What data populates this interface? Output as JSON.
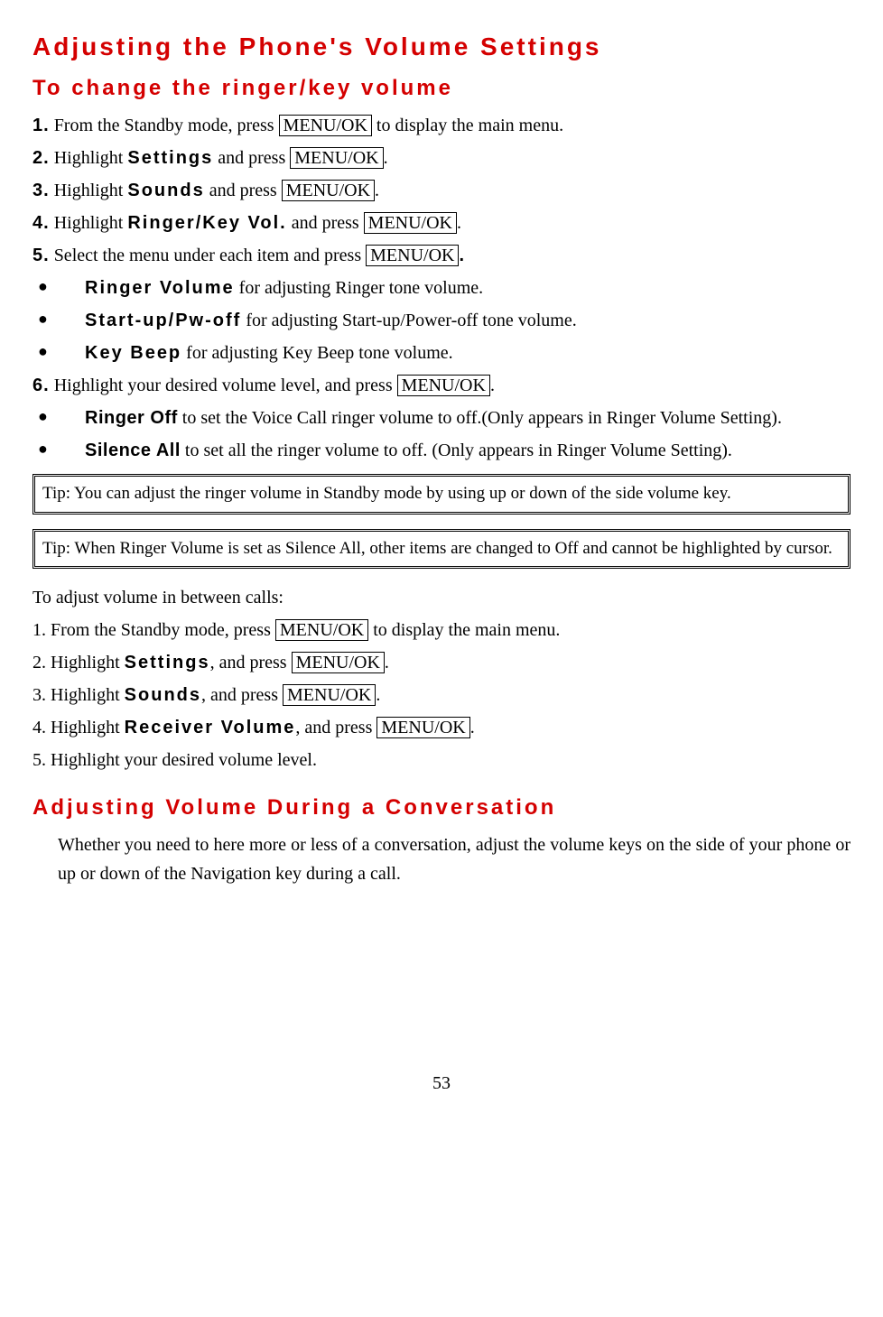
{
  "h1": "Adjusting the Phone's Volume Settings",
  "h2": "To change the ringer/key volume",
  "menuok": "MENU/OK",
  "s1": {
    "n1": "1.",
    "t1a": " From the Standby mode, press ",
    "t1b": " to display the main menu.",
    "n2": "2.",
    "t2a": " Highlight ",
    "t2h": "Settings",
    "t2b": " and press ",
    "t2c": ".",
    "n3": "3.",
    "t3a": " Highlight ",
    "t3h": "Sounds",
    "t3b": " and press ",
    "t3c": ".",
    "n4": "4.",
    "t4a": " Highlight ",
    "t4h": "Ringer/Key Vol.",
    "t4b": " and press ",
    "t4c": ".",
    "n5": "5.",
    "t5a": " Select the menu under each item and press ",
    "n5dot": ".",
    "b1h": "Ringer Volume",
    "b1t": " for adjusting Ringer tone volume.",
    "b2h": "Start-up/Pw-off",
    "b2t": " for adjusting Start-up/Power-off tone volume.",
    "b3h": "Key Beep",
    "b3t": " for adjusting Key Beep tone volume.",
    "n6": "6.",
    "t6a": " Highlight your desired volume level, and press ",
    "t6c": ".",
    "b4h": "Ringer Off",
    "b4t": " to set the Voice Call ringer volume to off.(Only appears in Ringer Volume Setting).",
    "b5h": "Silence All",
    "b5t": " to set all the ringer volume to off. (Only appears in Ringer Volume Setting)."
  },
  "tip1": "Tip: You can adjust the ringer volume in Standby mode by using up or down of the side volume key.",
  "tip2": "Tip: When Ringer Volume is set as Silence All, other items are changed to Off and cannot be highlighted by cursor.",
  "s2": {
    "intro": "To adjust volume in between calls:",
    "l1a": "1. From the Standby mode, press ",
    "l1b": " to display the main menu.",
    "l2a": "2. Highlight ",
    "l2h": "Settings",
    "l2b": ", and press ",
    "l2c": ".",
    "l3a": "3. Highlight ",
    "l3h": "Sounds",
    "l3b": ", and press ",
    "l3c": ".",
    "l4a": "4. Highlight ",
    "l4h": "Receiver Volume",
    "l4b": ", and press ",
    "l4c": ".",
    "l5": "5. Highlight your desired volume level."
  },
  "h3": "Adjusting Volume During a Conversation",
  "s3": "Whether you need to here more or less of a conversation, adjust the volume keys on the side of your phone or up or down of the Navigation key during a call.",
  "page": "53"
}
